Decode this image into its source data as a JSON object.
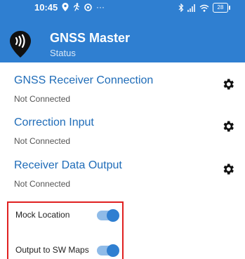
{
  "status_bar": {
    "time": "10:45",
    "left_icons": [
      "location-pin-icon",
      "running-figure-icon",
      "notification-icon"
    ],
    "overflow": "···",
    "right_icons": [
      "bluetooth-icon",
      "signal-icon",
      "wifi-icon"
    ],
    "battery_level": "28"
  },
  "app": {
    "title": "GNSS Master",
    "subtitle": "Status"
  },
  "sections": [
    {
      "title": "GNSS Receiver Connection",
      "status": "Not Connected"
    },
    {
      "title": "Correction Input",
      "status": "Not Connected"
    },
    {
      "title": "Receiver Data Output",
      "status": "Not Connected"
    }
  ],
  "toggles": [
    {
      "label": "Mock Location",
      "on": true
    },
    {
      "label": "Output to SW Maps",
      "on": true
    }
  ],
  "colors": {
    "appbar": "#2f7fd1",
    "title_text": "#1f6cb8",
    "highlight_box": "#e02020"
  }
}
